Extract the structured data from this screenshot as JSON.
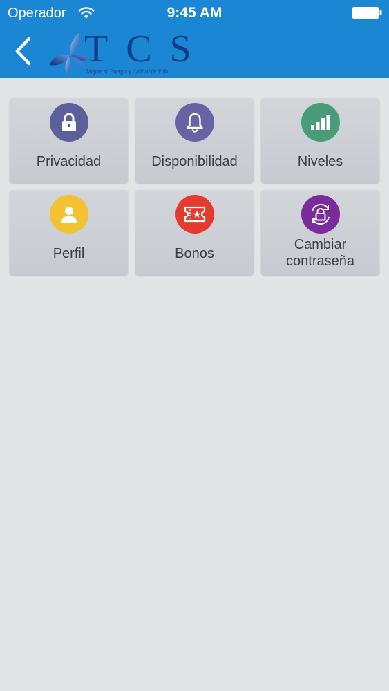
{
  "status_bar": {
    "carrier": "Operador",
    "time": "9:45 AM",
    "icons": [
      "wifi-icon",
      "battery-icon"
    ]
  },
  "nav": {
    "back_icon": "chevron-left-icon",
    "logo": {
      "letters": "TCS",
      "tagline": "Mejore su Energía y Calidad de Vida"
    }
  },
  "colors": {
    "header": "#1a86d4",
    "background": "#e3e4e6",
    "tile": "#cdd0d5",
    "label": "#3a3d42"
  },
  "tiles": [
    {
      "label": "Privacidad",
      "icon": "lock-icon",
      "color": "#5c5f99"
    },
    {
      "label": "Disponibilidad",
      "icon": "bell-icon",
      "color": "#6664a3"
    },
    {
      "label": "Niveles",
      "icon": "signal-bars-icon",
      "color": "#4a9b7a"
    },
    {
      "label": "Perfil",
      "icon": "user-icon",
      "color": "#f1c232"
    },
    {
      "label": "Bonos",
      "icon": "ticket-icon",
      "color": "#e53a2e"
    },
    {
      "label": "Cambiar contraseña",
      "icon": "lock-refresh-icon",
      "color": "#7b2b9c"
    }
  ]
}
